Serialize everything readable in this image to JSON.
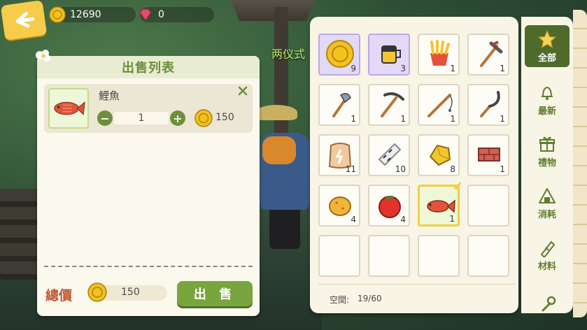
{
  "hud": {
    "coins": "12690",
    "gems": "0"
  },
  "world": {
    "sign_text": "两仪式"
  },
  "sell_panel": {
    "title": "出售列表",
    "item": {
      "name": "鯉魚",
      "quantity": "1",
      "price": "150"
    },
    "total_label": "總價",
    "total_value": "150",
    "sell_button": "出 售"
  },
  "inventory": {
    "slots": [
      {
        "icon": "gold-coin-icon",
        "count": "9",
        "highlight": "purple"
      },
      {
        "icon": "mug-icon",
        "count": "3",
        "highlight": "purple"
      },
      {
        "icon": "fries-icon",
        "count": "1"
      },
      {
        "icon": "pickaxe-axe-icon",
        "count": "1"
      },
      {
        "icon": "axe-icon",
        "count": "1"
      },
      {
        "icon": "pickaxe-icon",
        "count": "1"
      },
      {
        "icon": "fishing-rod-icon",
        "count": "1"
      },
      {
        "icon": "sickle-icon",
        "count": "1"
      },
      {
        "icon": "flour-sack-icon",
        "count": "11"
      },
      {
        "icon": "birch-log-icon",
        "count": "10"
      },
      {
        "icon": "gold-ore-icon",
        "count": "8"
      },
      {
        "icon": "brick-icon",
        "count": "1"
      },
      {
        "icon": "potato-icon",
        "count": "4"
      },
      {
        "icon": "tomato-icon",
        "count": "4"
      },
      {
        "icon": "carp-fish-icon",
        "count": "1",
        "highlight": "selected"
      },
      {
        "icon": "",
        "count": ""
      },
      {
        "icon": "",
        "count": ""
      },
      {
        "icon": "",
        "count": ""
      },
      {
        "icon": "",
        "count": ""
      },
      {
        "icon": "",
        "count": ""
      }
    ],
    "space_label": "空間:",
    "space_value": "19/60"
  },
  "categories": [
    {
      "label": "全部",
      "icon": "star-icon",
      "active": true
    },
    {
      "label": "最新",
      "icon": "bell-icon"
    },
    {
      "label": "禮物",
      "icon": "gift-icon"
    },
    {
      "label": "消耗",
      "icon": "rice-ball-icon"
    },
    {
      "label": "材料",
      "icon": "log-icon"
    },
    {
      "label": "",
      "icon": "tool-icon"
    }
  ],
  "colors": {
    "accent_green": "#6b8e3a",
    "sell_button": "#78a53e",
    "total_label": "#c0562e",
    "selected_border": "#f2cf3d"
  }
}
